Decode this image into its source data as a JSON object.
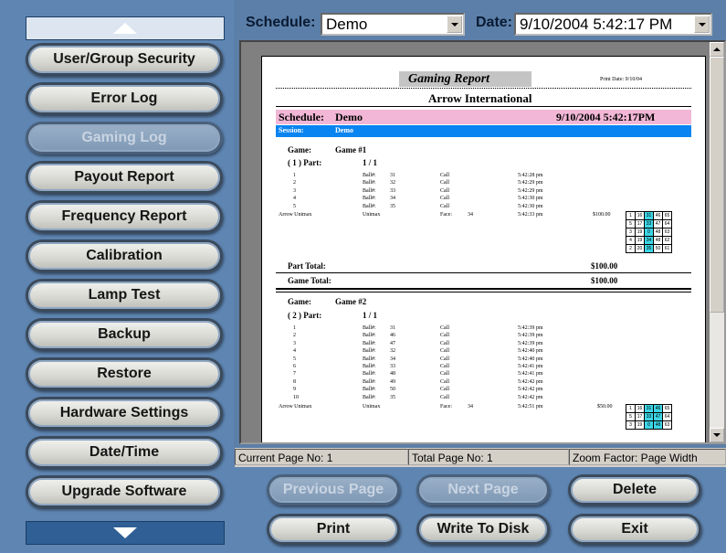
{
  "sidebar": {
    "buttons": [
      {
        "label": "User/Group Security",
        "enabled": true
      },
      {
        "label": "Error Log",
        "enabled": true
      },
      {
        "label": "Gaming Log",
        "enabled": false
      },
      {
        "label": "Payout Report",
        "enabled": true
      },
      {
        "label": "Frequency Report",
        "enabled": true
      },
      {
        "label": "Calibration",
        "enabled": true
      },
      {
        "label": "Lamp Test",
        "enabled": true
      },
      {
        "label": "Backup",
        "enabled": true
      },
      {
        "label": "Restore",
        "enabled": true
      },
      {
        "label": "Hardware Settings",
        "enabled": true
      },
      {
        "label": "Date/Time",
        "enabled": true
      },
      {
        "label": "Upgrade Software",
        "enabled": true
      }
    ]
  },
  "toolbar": {
    "schedule_label": "Schedule:",
    "schedule_value": "Demo",
    "date_label": "Date:",
    "date_value": "9/10/2004 5:42:17 PM"
  },
  "report": {
    "title": "Gaming Report",
    "print_date": "Print Date:   9/10/04",
    "company": "Arrow International",
    "schedule_label": "Schedule:",
    "schedule_name": "Demo",
    "schedule_datetime": "9/10/2004   5:42:17PM",
    "session_label": "Session:",
    "session_name": "Demo",
    "games": [
      {
        "game_label": "Game:",
        "game_name": "Game #1",
        "part_label": "( 1 ) Part:",
        "part_value": "1 / 1",
        "rows": [
          [
            "1",
            "Ball#:",
            "31",
            "Call",
            "5:42:28 pm"
          ],
          [
            "2",
            "Ball#:",
            "32",
            "Call",
            "5:42:29 pm"
          ],
          [
            "3",
            "Ball#:",
            "33",
            "Call",
            "5:42:29 pm"
          ],
          [
            "4",
            "Ball#:",
            "34",
            "Call",
            "5:42:30 pm"
          ],
          [
            "5",
            "Ball#:",
            "35",
            "Call",
            "5:42:30 pm"
          ]
        ],
        "winner": {
          "name": "Arrow Unimax",
          "type": "Unimax",
          "face_label": "Face:",
          "face": "34",
          "time": "5:42:33 pm",
          "amount": "$100.00"
        },
        "card": [
          [
            "1",
            "16",
            "31",
            "46",
            "65"
          ],
          [
            "5",
            "17",
            "33",
            "47",
            "64"
          ],
          [
            "3",
            "19",
            "0",
            "48",
            "63"
          ],
          [
            "4",
            "19",
            "34",
            "48",
            "62"
          ],
          [
            "2",
            "20",
            "35",
            "50",
            "61"
          ]
        ],
        "part_total_label": "Part Total:",
        "part_total": "$100.00",
        "game_total_label": "Game Total:",
        "game_total": "$100.00"
      },
      {
        "game_label": "Game:",
        "game_name": "Game #2",
        "part_label": "( 2 ) Part:",
        "part_value": "1 / 1",
        "rows": [
          [
            "1",
            "Ball#:",
            "31",
            "Call",
            "5:42:39 pm"
          ],
          [
            "2",
            "Ball#:",
            "46",
            "Call",
            "5:42:39 pm"
          ],
          [
            "3",
            "Ball#:",
            "47",
            "Call",
            "5:42:39 pm"
          ],
          [
            "4",
            "Ball#:",
            "32",
            "Call",
            "5:42:40 pm"
          ],
          [
            "5",
            "Ball#:",
            "34",
            "Call",
            "5:42:40 pm"
          ],
          [
            "6",
            "Ball#:",
            "33",
            "Call",
            "5:42:41 pm"
          ],
          [
            "7",
            "Ball#:",
            "48",
            "Call",
            "5:42:41 pm"
          ],
          [
            "8",
            "Ball#:",
            "49",
            "Call",
            "5:42:42 pm"
          ],
          [
            "9",
            "Ball#:",
            "50",
            "Call",
            "5:42:42 pm"
          ],
          [
            "10",
            "Ball#:",
            "35",
            "Call",
            "5:42:42 pm"
          ]
        ],
        "winner": {
          "name": "Arrow Unimax",
          "type": "Unimax",
          "face_label": "Face:",
          "face": "34",
          "time": "5:42:51 pm",
          "amount": "$50.00"
        },
        "card": [
          [
            "1",
            "16",
            "31",
            "46",
            "65"
          ],
          [
            "5",
            "17",
            "33",
            "47",
            "64"
          ],
          [
            "3",
            "19",
            "0",
            "48",
            "63"
          ]
        ]
      }
    ],
    "colors": {
      "schedule_band": "#f2b7d6",
      "session_band": "#0a84f0",
      "highlight": "#3cd6e6",
      "title_band": "#c4c4c4"
    }
  },
  "status": {
    "current_page": "Current Page No: 1",
    "total_page": "Total Page No: 1",
    "zoom": "Zoom Factor: Page Width"
  },
  "actions": {
    "previous": "Previous Page",
    "next": "Next Page",
    "delete": "Delete",
    "print": "Print",
    "write": "Write To Disk",
    "exit": "Exit"
  },
  "icons": {
    "up": "triangle-up-icon",
    "down": "triangle-down-icon",
    "dropdown": "dropdown-arrow-icon"
  }
}
